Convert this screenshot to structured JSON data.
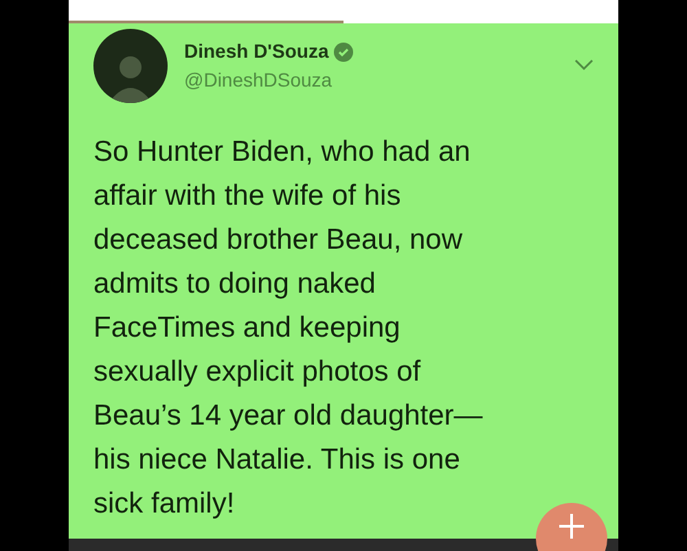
{
  "tweet": {
    "author": "Dinesh D'Souza",
    "verified": true,
    "handle": "@DineshDSouza",
    "lines": [
      "So Hunter Biden, who had an",
      "affair with the wife of his",
      "deceased brother Beau, now",
      "admits to doing naked",
      "FaceTimes and keeping",
      "sexually explicit photos of",
      "Beau’s 14 year old daughter—",
      "his niece Natalie. This is one",
      "sick family!"
    ]
  }
}
